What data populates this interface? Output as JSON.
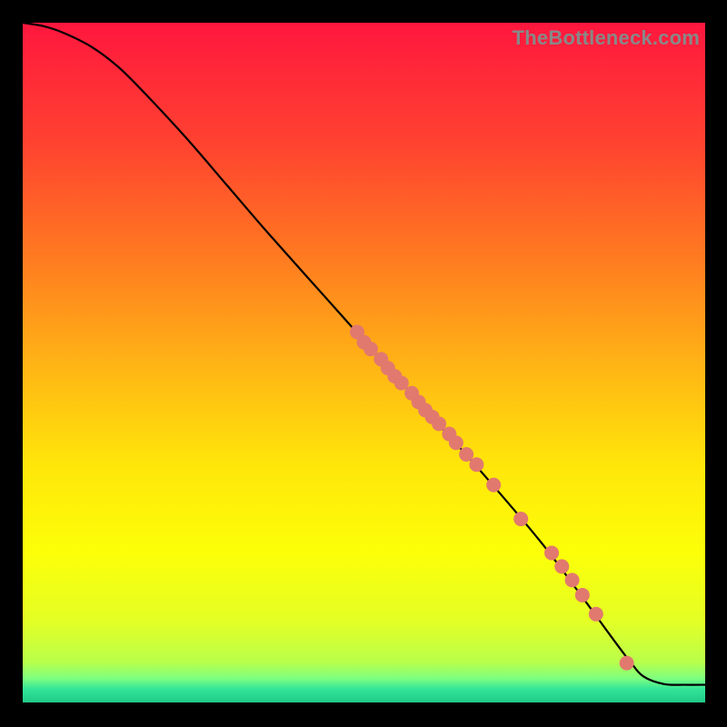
{
  "watermark": "TheBottleneck.com",
  "colors": {
    "marker_fill": "#e2796e",
    "marker_stroke": "#9b4a42",
    "curve": "#000000"
  },
  "chart_data": {
    "type": "line",
    "title": "",
    "xlabel": "",
    "ylabel": "",
    "xlim": [
      0,
      100
    ],
    "ylim": [
      0,
      100
    ],
    "axes_visible": false,
    "background_gradient": {
      "stops": [
        {
          "pos": 0.0,
          "color": "#ff173e"
        },
        {
          "pos": 0.18,
          "color": "#ff4330"
        },
        {
          "pos": 0.35,
          "color": "#ff7c20"
        },
        {
          "pos": 0.5,
          "color": "#ffb315"
        },
        {
          "pos": 0.65,
          "color": "#ffe60a"
        },
        {
          "pos": 0.78,
          "color": "#fcff08"
        },
        {
          "pos": 0.88,
          "color": "#e4ff25"
        },
        {
          "pos": 0.94,
          "color": "#baff4a"
        },
        {
          "pos": 0.965,
          "color": "#7dff80"
        },
        {
          "pos": 0.98,
          "color": "#33e598"
        },
        {
          "pos": 1.0,
          "color": "#1fca88"
        }
      ]
    },
    "series": [
      {
        "name": "bottleneck-curve",
        "x": [
          0,
          3,
          6,
          10,
          14,
          18,
          24,
          30,
          36,
          44,
          52,
          60,
          68,
          76,
          82,
          86,
          89,
          91,
          94,
          97,
          100
        ],
        "y": [
          100,
          99.5,
          98.5,
          96.5,
          93.5,
          89.5,
          83,
          76,
          69,
          60,
          51,
          42,
          33,
          23.5,
          15.5,
          10,
          6,
          3.8,
          2.7,
          2.6,
          2.6
        ]
      }
    ],
    "markers": {
      "name": "highlight-points",
      "x": [
        49,
        50,
        51,
        52.5,
        53.5,
        54.5,
        55.5,
        57,
        58,
        59,
        60,
        61,
        62.5,
        63.5,
        65,
        66.5,
        69,
        73,
        77.5,
        79,
        80.5,
        82,
        84,
        88.5
      ],
      "y": [
        54.5,
        53,
        52,
        50.5,
        49.2,
        48,
        47,
        45.5,
        44.2,
        43,
        42,
        41,
        39.5,
        38.2,
        36.5,
        35,
        32,
        27,
        22,
        20,
        18,
        15.8,
        13,
        5.8
      ],
      "radius": 8
    }
  }
}
